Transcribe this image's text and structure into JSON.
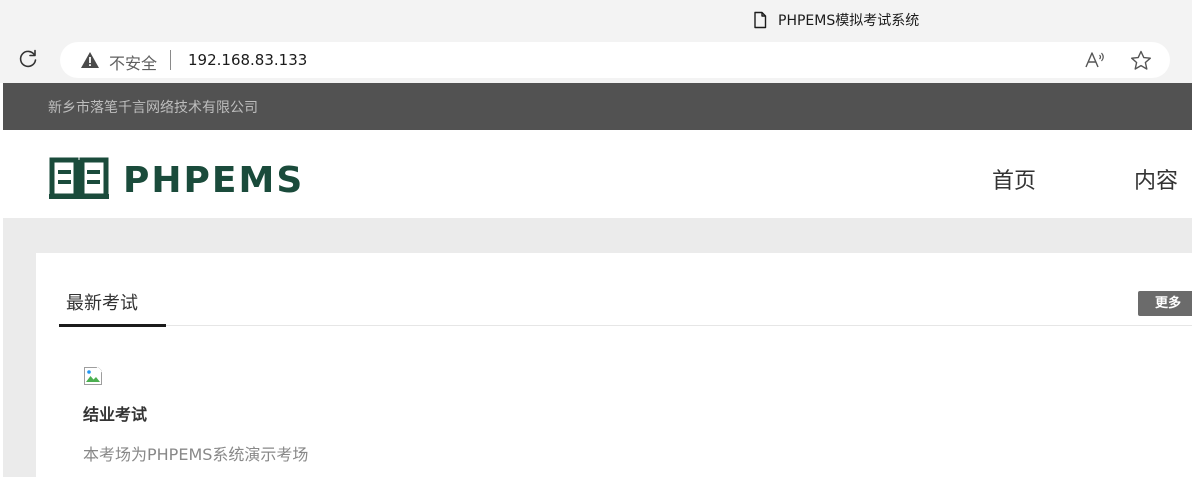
{
  "browser": {
    "tab_title": "PHPEMS模拟考试系统",
    "insecure_label": "不安全",
    "url": "192.168.83.133"
  },
  "site": {
    "company": "新乡市落笔千言网络技术有限公司",
    "logo_text": "PHPEMS",
    "nav": {
      "home": "首页",
      "content": "内容"
    }
  },
  "section": {
    "title": "最新考试",
    "more_label": "更多"
  },
  "exam": {
    "title": "结业考试",
    "description": "本考场为PHPEMS系统演示考场"
  },
  "colors": {
    "logo_green": "#1a4b3b",
    "topbar_gray": "#525252",
    "more_button": "#6b6b6b"
  },
  "icons": [
    "document-icon",
    "refresh-icon",
    "warning-icon",
    "read-aloud-icon",
    "star-icon",
    "logo-book-icon",
    "broken-image-icon"
  ]
}
